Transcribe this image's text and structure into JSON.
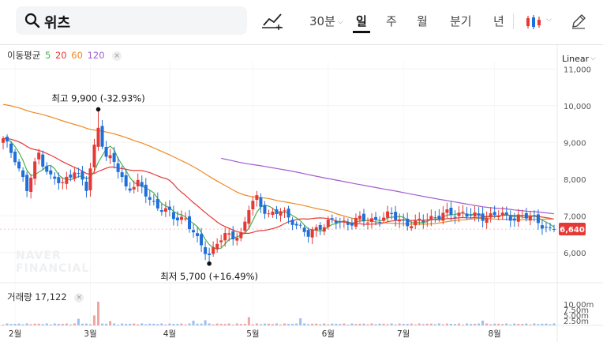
{
  "search": {
    "query": "위츠"
  },
  "periods": [
    {
      "label": "30분",
      "caret": "⌵",
      "active": false
    },
    {
      "label": "일",
      "active": true
    },
    {
      "label": "주",
      "active": false
    },
    {
      "label": "월",
      "active": false
    },
    {
      "label": "분기",
      "active": false
    },
    {
      "label": "년",
      "active": false
    }
  ],
  "indicator_legend": {
    "label": "이동평균",
    "periods": [
      {
        "value": "5",
        "color": "#4caf50"
      },
      {
        "value": "20",
        "color": "#e53935"
      },
      {
        "value": "60",
        "color": "#f08a24"
      },
      {
        "value": "120",
        "color": "#a25ed0"
      }
    ],
    "close": "×"
  },
  "scale": {
    "label": "Linear",
    "caret": "⌵"
  },
  "volume_legend": {
    "label": "거래량",
    "value": "17,122",
    "close": "×"
  },
  "watermark": [
    "NAVER",
    "FINANCIAL"
  ],
  "chart_data": {
    "type": "candlestick",
    "price_axis": {
      "ticks": [
        6000,
        7000,
        8000,
        9000,
        10000,
        11000
      ],
      "tick_labels": [
        "6,000",
        "7,000",
        "8,000",
        "9,000",
        "10,000",
        "11,000"
      ],
      "range": [
        5200,
        11200
      ]
    },
    "volume_axis": {
      "tick_labels": [
        "10.00m",
        "7.50m",
        "5.00m",
        "2.50m"
      ]
    },
    "x_axis": {
      "months": [
        {
          "label": "2월",
          "day": 3
        },
        {
          "label": "3월",
          "day": 22
        },
        {
          "label": "4월",
          "day": 42
        },
        {
          "label": "5월",
          "day": 63
        },
        {
          "label": "6월",
          "day": 82
        },
        {
          "label": "7월",
          "day": 101
        },
        {
          "label": "8월",
          "day": 124
        }
      ],
      "last_day": 139
    },
    "current_price": {
      "value": 6640,
      "label": "6,640",
      "color": "#e53935"
    },
    "high": {
      "label": "최고 9,900 (-32.93%)",
      "value": 9900,
      "day": 24
    },
    "low": {
      "label": "최저 5,700 (+16.49%)",
      "value": 5700,
      "day": 52
    },
    "up_color": "#e53935",
    "down_color": "#1e6fd9",
    "close_anchors": [
      [
        0,
        9050
      ],
      [
        3,
        8600
      ],
      [
        6,
        7700
      ],
      [
        9,
        8700
      ],
      [
        12,
        8050
      ],
      [
        15,
        7850
      ],
      [
        18,
        8300
      ],
      [
        21,
        7700
      ],
      [
        24,
        9450
      ],
      [
        26,
        8600
      ],
      [
        28,
        8450
      ],
      [
        31,
        7800
      ],
      [
        34,
        7850
      ],
      [
        37,
        7450
      ],
      [
        40,
        7200
      ],
      [
        43,
        6950
      ],
      [
        46,
        6950
      ],
      [
        49,
        6300
      ],
      [
        52,
        5950
      ],
      [
        54,
        6300
      ],
      [
        57,
        6450
      ],
      [
        60,
        6500
      ],
      [
        62,
        7200
      ],
      [
        64,
        7450
      ],
      [
        67,
        7050
      ],
      [
        70,
        7100
      ],
      [
        73,
        6900
      ],
      [
        75,
        6650
      ],
      [
        77,
        6450
      ],
      [
        80,
        6750
      ],
      [
        83,
        6850
      ],
      [
        86,
        6800
      ],
      [
        89,
        6900
      ],
      [
        92,
        6850
      ],
      [
        95,
        6950
      ],
      [
        98,
        7000
      ],
      [
        101,
        6850
      ],
      [
        104,
        6750
      ],
      [
        107,
        6950
      ],
      [
        110,
        7000
      ],
      [
        113,
        7050
      ],
      [
        116,
        7100
      ],
      [
        119,
        6950
      ],
      [
        122,
        7000
      ],
      [
        124,
        7050
      ],
      [
        127,
        6950
      ],
      [
        130,
        7000
      ],
      [
        133,
        6950
      ],
      [
        136,
        6800
      ],
      [
        138,
        6600
      ],
      [
        139,
        6640
      ]
    ],
    "ma_series": [
      {
        "name": "5",
        "color": "#4caf50",
        "window": 5
      },
      {
        "name": "20",
        "color": "#e53935",
        "window": 20
      },
      {
        "name": "60",
        "color": "#f08a24",
        "window": 60
      },
      {
        "name": "120",
        "color": "#a25ed0",
        "window": 120
      }
    ],
    "ma_seed": {
      "60": 10050,
      "120": 9300
    },
    "volume_spikes": [
      {
        "day": 24,
        "value": 10.0
      },
      {
        "day": 23,
        "value": 4.2
      },
      {
        "day": 62,
        "value": 3.5
      },
      {
        "day": 48,
        "value": 2.0
      },
      {
        "day": 51,
        "value": 2.2
      },
      {
        "day": 75,
        "value": 3.0
      },
      {
        "day": 19,
        "value": 2.8
      },
      {
        "day": 27,
        "value": 1.8
      },
      {
        "day": 121,
        "value": 2.0
      }
    ]
  }
}
